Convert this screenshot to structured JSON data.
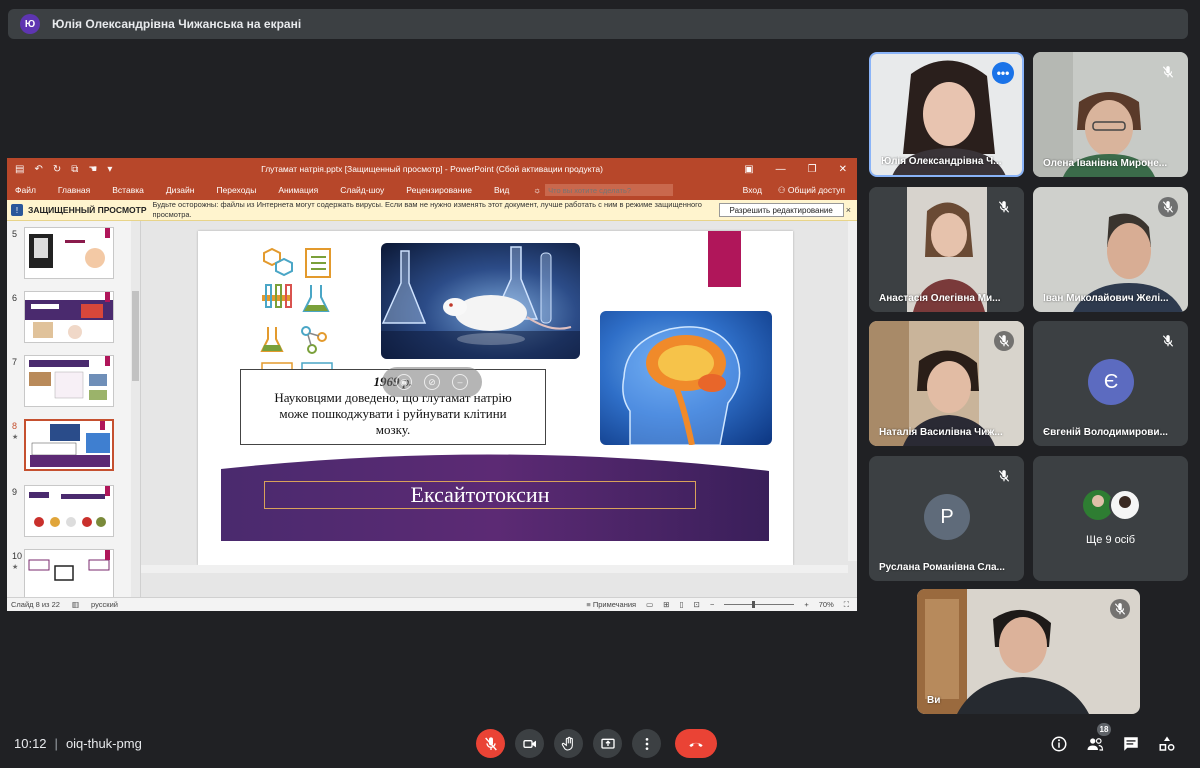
{
  "presenter_banner": {
    "avatar_letter": "Ю",
    "title": "Юлія Олександрівна Чижанська на екрані"
  },
  "powerpoint": {
    "doc_title": "Глутамат натрія.pptx [Защищенный просмотр] - PowerPoint (Сбой активации продукта)",
    "ribbon_tabs": [
      "Файл",
      "Главная",
      "Вставка",
      "Дизайн",
      "Переходы",
      "Анимация",
      "Слайд-шоу",
      "Рецензирование",
      "Вид"
    ],
    "tell_me_placeholder": "Что вы хотите сделать?",
    "sign_in": "Вход",
    "share": "Общий доступ",
    "protected_view": {
      "label": "ЗАЩИЩЕННЫЙ ПРОСМОТР",
      "message": "Будьте осторожны: файлы из Интернета могут содержать вирусы. Если вам не нужно изменять этот документ, лучше работать с ним в режиме защищенного просмотра.",
      "enable_button": "Разрешить редактирование",
      "close": "×"
    },
    "thumbnails": [
      {
        "num": "5",
        "star": ""
      },
      {
        "num": "6",
        "star": ""
      },
      {
        "num": "7",
        "star": ""
      },
      {
        "num": "8",
        "star": "★"
      },
      {
        "num": "9",
        "star": ""
      },
      {
        "num": "10",
        "star": "★"
      }
    ],
    "slide": {
      "year": "1969 р.",
      "text_line1": "Науковцями доведено, що глутамат натрію",
      "text_line2": "може пошкоджувати і руйнувати клітини",
      "text_line3": "мозку.",
      "title": "Ексайтотоксин"
    },
    "status": {
      "slide_counter": "Слайд 8 из 22",
      "language": "русский",
      "notes": "Примечания",
      "zoom": "70%"
    }
  },
  "participants": [
    {
      "name": "Юлія Олександрівна Ч...",
      "kind": "video",
      "active": true
    },
    {
      "name": "Олена Іванівна Мироне...",
      "kind": "video",
      "muted": true
    },
    {
      "name": "Анастасія Олегівна Ми...",
      "kind": "video",
      "muted": true
    },
    {
      "name": "Іван Миколайович Желі...",
      "kind": "video",
      "muted": true
    },
    {
      "name": "Наталія Василівна Чиж...",
      "kind": "video",
      "muted": true
    },
    {
      "name": "Євгеній Володимирови...",
      "kind": "avatar",
      "letter": "Є",
      "color": "#5c6bc0",
      "muted": true
    },
    {
      "name": "Руслана Романівна Сла...",
      "kind": "avatar",
      "letter": "P",
      "color": "#5f6b7a",
      "muted": true
    },
    {
      "name": "Ще 9 осіб",
      "kind": "more"
    },
    {
      "name": "Ви",
      "kind": "self",
      "muted": true
    }
  ],
  "bottom_bar": {
    "time": "10:12",
    "meeting_code": "oiq-thuk-pmg",
    "people_count": "18"
  }
}
